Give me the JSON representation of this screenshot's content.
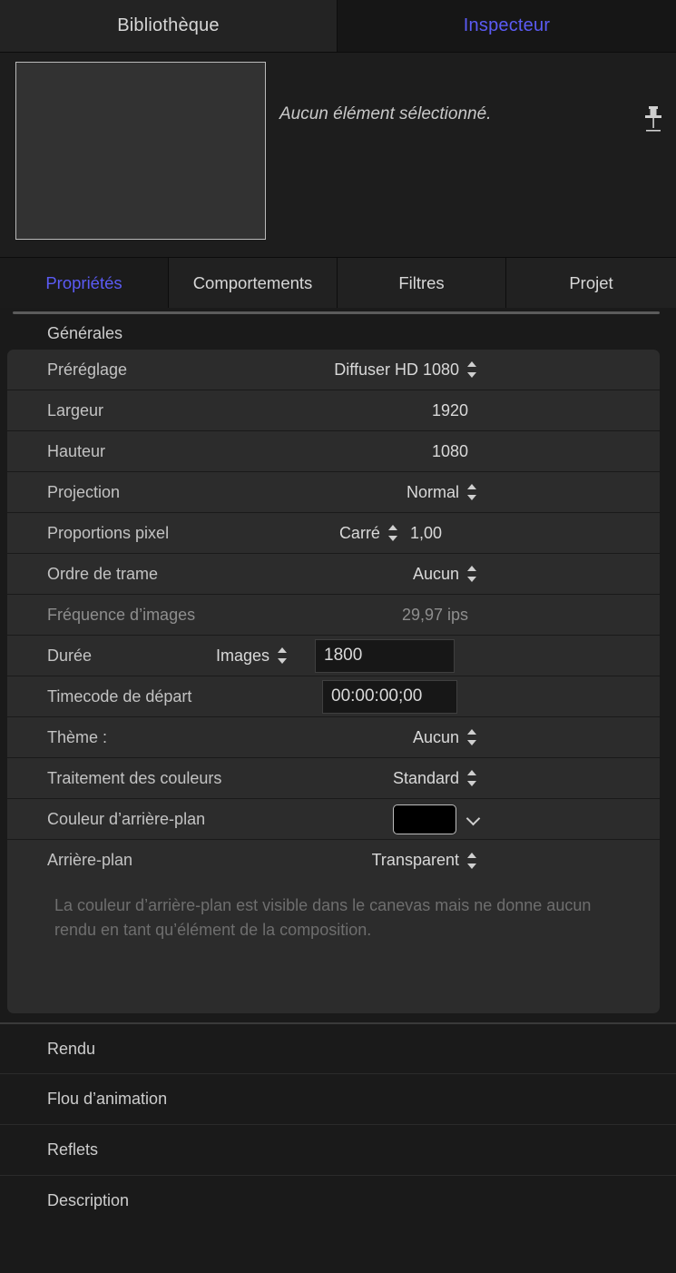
{
  "top_tabs": [
    {
      "label": "Bibliothèque",
      "active": false
    },
    {
      "label": "Inspecteur",
      "active": true
    }
  ],
  "preview": {
    "empty_message": "Aucun élément sélectionné.",
    "pin_icon": "pushpin-icon"
  },
  "inspector_tabs": [
    {
      "label": "Propriétés",
      "active": true
    },
    {
      "label": "Comportements",
      "active": false
    },
    {
      "label": "Filtres",
      "active": false
    },
    {
      "label": "Projet",
      "active": false
    }
  ],
  "general": {
    "group_title": "Générales",
    "rows": {
      "preset": {
        "label": "Préréglage",
        "value": "Diffuser HD 1080"
      },
      "width": {
        "label": "Largeur",
        "value": "1920"
      },
      "height": {
        "label": "Hauteur",
        "value": "1080"
      },
      "projection": {
        "label": "Projection",
        "value": "Normal"
      },
      "pixel_aspect": {
        "label": "Proportions pixel",
        "value": "Carré",
        "ratio": "1,00"
      },
      "field_order": {
        "label": "Ordre de trame",
        "value": "Aucun"
      },
      "frame_rate": {
        "label": "Fréquence d’images",
        "value": "29,97 ips"
      },
      "duration": {
        "label": "Durée",
        "unit": "Images",
        "value": "1800"
      },
      "start_timecode": {
        "label": "Timecode de départ",
        "value": "00:00:00;00"
      },
      "theme": {
        "label": "Thème :",
        "value": "Aucun"
      },
      "color_process": {
        "label": "Traitement des couleurs",
        "value": "Standard"
      },
      "bg_color": {
        "label": "Couleur d’arrière-plan",
        "swatch": "#000000"
      },
      "background": {
        "label": "Arrière-plan",
        "value": "Transparent"
      }
    },
    "help_text": "La couleur d’arrière-plan est visible dans le canevas mais ne donne aucun rendu en tant qu’élément de la composition."
  },
  "sections": [
    {
      "label": "Rendu"
    },
    {
      "label": "Flou d’animation"
    },
    {
      "label": "Reflets"
    },
    {
      "label": "Description"
    }
  ],
  "colors": {
    "accent": "#5b5bf5",
    "row_bg": "#2c2c2c",
    "panel_bg": "#1a1a1a",
    "swatch": "#000000"
  }
}
